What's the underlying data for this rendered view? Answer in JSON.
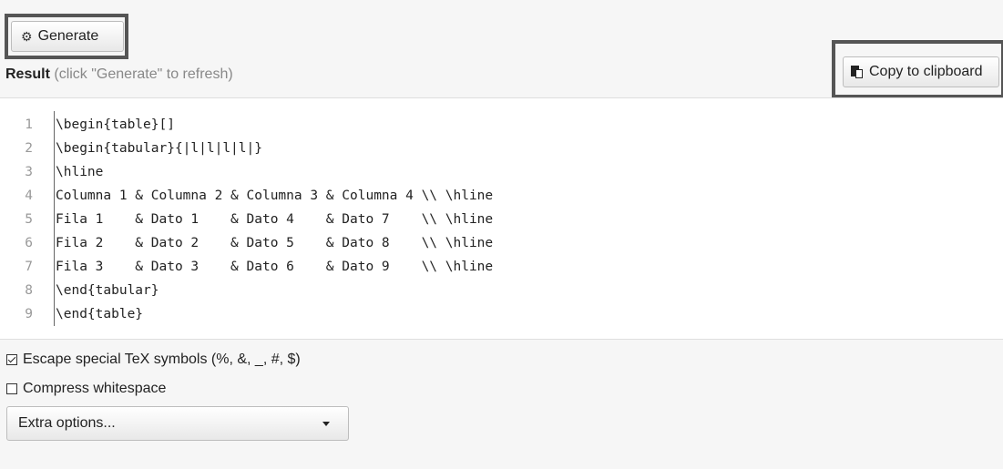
{
  "toolbar": {
    "generate_label": "Generate",
    "generate_icon": "gears-icon",
    "copy_label": "Copy to clipboard",
    "copy_icon": "clipboard-icon"
  },
  "result": {
    "title": "Result",
    "hint": "(click \"Generate\" to refresh)"
  },
  "code": {
    "lines": [
      {
        "num": "1",
        "text": "\\begin{table}[]"
      },
      {
        "num": "2",
        "text": "\\begin{tabular}{|l|l|l|l|}"
      },
      {
        "num": "3",
        "text": "\\hline"
      },
      {
        "num": "4",
        "text": "Columna 1 & Columna 2 & Columna 3 & Columna 4 \\\\ \\hline"
      },
      {
        "num": "5",
        "text": "Fila 1    & Dato 1    & Dato 4    & Dato 7    \\\\ \\hline"
      },
      {
        "num": "6",
        "text": "Fila 2    & Dato 2    & Dato 5    & Dato 8    \\\\ \\hline"
      },
      {
        "num": "7",
        "text": "Fila 3    & Dato 3    & Dato 6    & Dato 9    \\\\ \\hline"
      },
      {
        "num": "8",
        "text": "\\end{tabular}"
      },
      {
        "num": "9",
        "text": "\\end{table}"
      }
    ]
  },
  "options": {
    "escape_label": "Escape special TeX symbols (%, &, _, #, $)",
    "escape_checked": true,
    "compress_label": "Compress whitespace",
    "compress_checked": false,
    "extra_label": "Extra options..."
  }
}
